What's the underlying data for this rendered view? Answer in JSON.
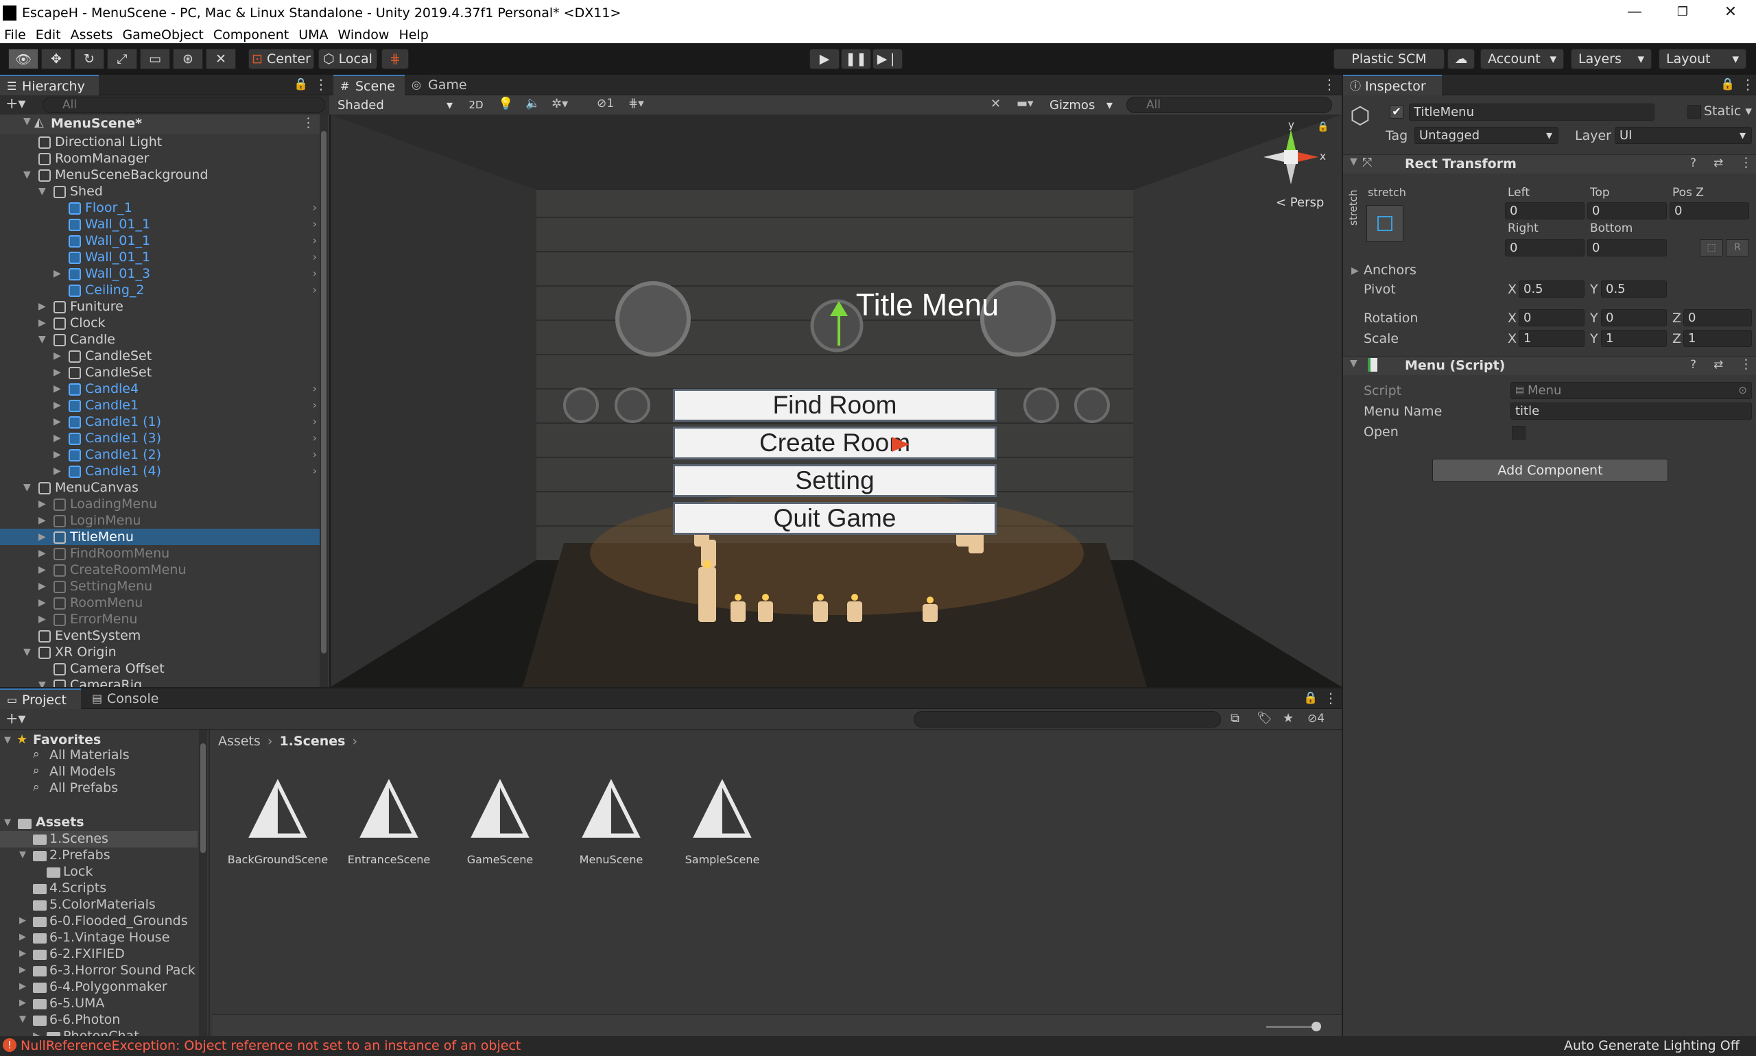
{
  "window": {
    "title": "EscapeH - MenuScene - PC, Mac & Linux Standalone - Unity 2019.4.37f1 Personal* <DX11>",
    "minimize": "—",
    "maximize": "❐",
    "close": "✕"
  },
  "menu": [
    "File",
    "Edit",
    "Assets",
    "GameObject",
    "Component",
    "UMA",
    "Window",
    "Help"
  ],
  "toolbar": {
    "center": "Center",
    "local": "Local",
    "plastic": "Plastic SCM",
    "account": "Account",
    "layers": "Layers",
    "layout": "Layout"
  },
  "hierarchy": {
    "tab": "Hierarchy",
    "search_placeholder": "All",
    "scene": "MenuScene*",
    "items": [
      {
        "label": "Directional Light",
        "depth": 1,
        "style": "normal",
        "arrow": false
      },
      {
        "label": "RoomManager",
        "depth": 1,
        "style": "normal",
        "arrow": false
      },
      {
        "label": "MenuSceneBackground",
        "depth": 1,
        "style": "normal",
        "arrow": "open"
      },
      {
        "label": "Shed",
        "depth": 2,
        "style": "normal",
        "arrow": "open"
      },
      {
        "label": "Floor_1",
        "depth": 3,
        "style": "blue",
        "arrow": false
      },
      {
        "label": "Wall_01_1",
        "depth": 3,
        "style": "blue",
        "arrow": false
      },
      {
        "label": "Wall_01_1",
        "depth": 3,
        "style": "blue",
        "arrow": false
      },
      {
        "label": "Wall_01_1",
        "depth": 3,
        "style": "blue",
        "arrow": false
      },
      {
        "label": "Wall_01_3",
        "depth": 3,
        "style": "blue",
        "arrow": "closed"
      },
      {
        "label": "Ceiling_2",
        "depth": 3,
        "style": "blue",
        "arrow": false
      },
      {
        "label": "Funiture",
        "depth": 2,
        "style": "normal",
        "arrow": "closed"
      },
      {
        "label": "Clock",
        "depth": 2,
        "style": "normal",
        "arrow": "closed"
      },
      {
        "label": "Candle",
        "depth": 2,
        "style": "normal",
        "arrow": "open"
      },
      {
        "label": "CandleSet",
        "depth": 3,
        "style": "normal",
        "arrow": "closed"
      },
      {
        "label": "CandleSet",
        "depth": 3,
        "style": "normal",
        "arrow": "closed"
      },
      {
        "label": "Candle4",
        "depth": 3,
        "style": "blue",
        "arrow": "closed"
      },
      {
        "label": "Candle1",
        "depth": 3,
        "style": "blue",
        "arrow": "closed"
      },
      {
        "label": "Candle1 (1)",
        "depth": 3,
        "style": "blue",
        "arrow": "closed"
      },
      {
        "label": "Candle1 (3)",
        "depth": 3,
        "style": "blue",
        "arrow": "closed"
      },
      {
        "label": "Candle1 (2)",
        "depth": 3,
        "style": "blue",
        "arrow": "closed"
      },
      {
        "label": "Candle1 (4)",
        "depth": 3,
        "style": "blue",
        "arrow": "closed"
      },
      {
        "label": "MenuCanvas",
        "depth": 1,
        "style": "normal",
        "arrow": "open"
      },
      {
        "label": "LoadingMenu",
        "depth": 2,
        "style": "dis",
        "arrow": "closed"
      },
      {
        "label": "LoginMenu",
        "depth": 2,
        "style": "dis",
        "arrow": "closed"
      },
      {
        "label": "TitleMenu",
        "depth": 2,
        "style": "sel",
        "arrow": "closed"
      },
      {
        "label": "FindRoomMenu",
        "depth": 2,
        "style": "dis",
        "arrow": "closed"
      },
      {
        "label": "CreateRoomMenu",
        "depth": 2,
        "style": "dis",
        "arrow": "closed"
      },
      {
        "label": "SettingMenu",
        "depth": 2,
        "style": "dis",
        "arrow": "closed"
      },
      {
        "label": "RoomMenu",
        "depth": 2,
        "style": "dis",
        "arrow": "closed"
      },
      {
        "label": "ErrorMenu",
        "depth": 2,
        "style": "dis",
        "arrow": "closed"
      },
      {
        "label": "EventSystem",
        "depth": 1,
        "style": "normal",
        "arrow": false
      },
      {
        "label": "XR Origin",
        "depth": 1,
        "style": "normal",
        "arrow": "open"
      },
      {
        "label": "Camera Offset",
        "depth": 2,
        "style": "normal",
        "arrow": false
      },
      {
        "label": "CameraRig",
        "depth": 2,
        "style": "normal",
        "arrow": "open"
      }
    ]
  },
  "scene_view": {
    "tab_scene": "Scene",
    "tab_game": "Game",
    "shading": "Shaded",
    "mode_2d": "2D",
    "hidden_count": "1",
    "gizmos": "Gizmos",
    "search_placeholder": "All",
    "persp": "< Persp",
    "axis_y": "y",
    "axis_x": "x",
    "game_ui": {
      "title": "Title Menu",
      "buttons": [
        "Find Room",
        "Create Room",
        "Setting",
        "Quit Game"
      ]
    }
  },
  "inspector": {
    "tab": "Inspector",
    "object_name": "TitleMenu",
    "static": "Static",
    "tag_label": "Tag",
    "tag_value": "Untagged",
    "layer_label": "Layer",
    "layer_value": "UI",
    "rect_transform": {
      "title": "Rect Transform",
      "stretch": "stretch",
      "left_label": "Left",
      "left": "0",
      "top_label": "Top",
      "top": "0",
      "posz_label": "Pos Z",
      "posz": "0",
      "right_label": "Right",
      "right": "0",
      "bottom_label": "Bottom",
      "bottom": "0",
      "r_button": "R",
      "anchors": "Anchors",
      "pivot": "Pivot",
      "pivot_x": "0.5",
      "pivot_y": "0.5",
      "rotation": "Rotation",
      "rot_x": "0",
      "rot_y": "0",
      "rot_z": "0",
      "scale": "Scale",
      "scale_x": "1",
      "scale_y": "1",
      "scale_z": "1",
      "x": "X",
      "y": "Y",
      "z": "Z"
    },
    "menu_script": {
      "title": "Menu (Script)",
      "script_label": "Script",
      "script_value": "Menu",
      "menu_name_label": "Menu Name",
      "menu_name_value": "title",
      "open_label": "Open"
    },
    "add_component": "Add Component"
  },
  "project": {
    "tab_project": "Project",
    "tab_console": "Console",
    "hidden_count": "4",
    "breadcrumb": [
      "Assets",
      "1.Scenes"
    ],
    "favorites_header": "Favorites",
    "favorites": [
      "All Materials",
      "All Models",
      "All Prefabs"
    ],
    "assets_header": "Assets",
    "folders": [
      {
        "label": "1.Scenes",
        "depth": 1,
        "arrow": false,
        "sel": true
      },
      {
        "label": "2.Prefabs",
        "depth": 1,
        "arrow": "open"
      },
      {
        "label": "Lock",
        "depth": 2,
        "arrow": false
      },
      {
        "label": "4.Scripts",
        "depth": 1,
        "arrow": false
      },
      {
        "label": "5.ColorMaterials",
        "depth": 1,
        "arrow": false
      },
      {
        "label": "6-0.Flooded_Grounds",
        "depth": 1,
        "arrow": "closed"
      },
      {
        "label": "6-1.Vintage House",
        "depth": 1,
        "arrow": "closed"
      },
      {
        "label": "6-2.FXIFIED",
        "depth": 1,
        "arrow": "closed"
      },
      {
        "label": "6-3.Horror Sound Pack",
        "depth": 1,
        "arrow": "closed"
      },
      {
        "label": "6-4.Polygonmaker",
        "depth": 1,
        "arrow": "closed"
      },
      {
        "label": "6-5.UMA",
        "depth": 1,
        "arrow": "closed"
      },
      {
        "label": "6-6.Photon",
        "depth": 1,
        "arrow": "open"
      },
      {
        "label": "PhotonChat",
        "depth": 2,
        "arrow": "closed"
      }
    ],
    "scenes": [
      "BackGroundScene",
      "EntranceScene",
      "GameScene",
      "MenuScene",
      "SampleScene"
    ]
  },
  "status": {
    "error": "NullReferenceException: Object reference not set to an instance of an object",
    "lighting": "Auto Generate Lighting Off"
  }
}
